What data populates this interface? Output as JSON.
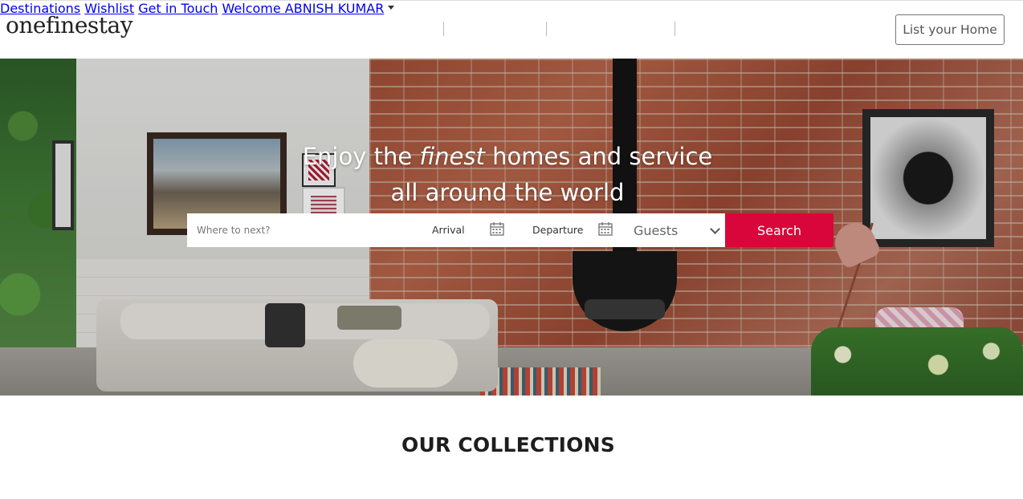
{
  "header": {
    "logo_text": "onefinestay",
    "nav": {
      "destinations": "Destinations",
      "wishlist": "Wishlist",
      "contact": "Get in Touch",
      "welcome": "Welcome ABNISH KUMAR"
    },
    "list_home_label": "List your Home"
  },
  "hero": {
    "headline_part1": "Enjoy the",
    "headline_emphasis": "finest",
    "headline_part2": "homes and service",
    "headline_line2": "all around the world"
  },
  "search": {
    "where_placeholder": "Where to next?",
    "arrival_label": "Arrival",
    "departure_label": "Departure",
    "guests_label": "Guests",
    "search_button": "Search"
  },
  "sections": {
    "collections_title": "OUR COLLECTIONS"
  },
  "colors": {
    "accent": "#d8063a",
    "text": "#222222"
  },
  "icons": {
    "calendar": "calendar-icon",
    "dropdown": "chevron-down-icon",
    "caret": "caret-down-icon"
  }
}
